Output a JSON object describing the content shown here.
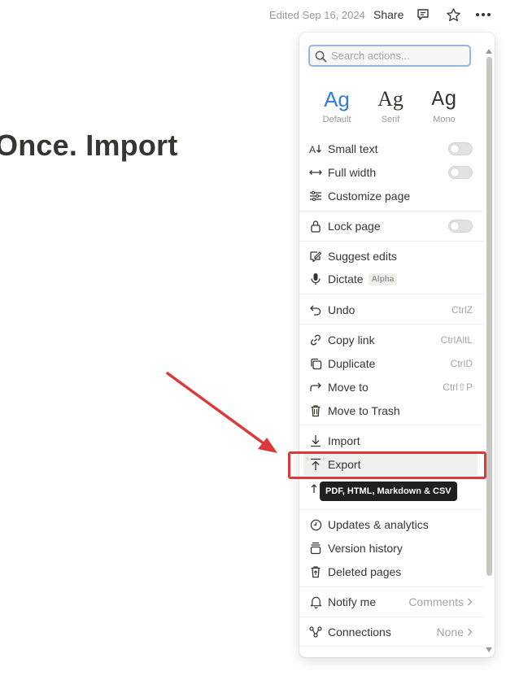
{
  "topbar": {
    "edited": "Edited Sep 16, 2024",
    "share": "Share",
    "icons": [
      "comment-icon",
      "star-icon",
      "more-icon"
    ]
  },
  "page": {
    "title": "Once. Import"
  },
  "menu": {
    "search": {
      "placeholder": "Search actions...",
      "value": ""
    },
    "fonts": [
      {
        "sample": "Ag",
        "label": "Default",
        "color": "#2f80d8",
        "selected": true
      },
      {
        "sample": "Ag",
        "label": "Serif",
        "color": "#37352f"
      },
      {
        "sample": "Ag",
        "label": "Mono",
        "color": "#37352f"
      }
    ],
    "items": {
      "small_text": {
        "label": "Small text",
        "toggle": false
      },
      "full_width": {
        "label": "Full width",
        "toggle": false
      },
      "customize_page": {
        "label": "Customize page"
      },
      "lock_page": {
        "label": "Lock page",
        "toggle": false
      },
      "suggest_edits": {
        "label": "Suggest edits"
      },
      "dictate": {
        "label": "Dictate",
        "badge": "Alpha"
      },
      "undo": {
        "label": "Undo",
        "shortcut": "CtrlZ"
      },
      "copy_link": {
        "label": "Copy link",
        "shortcut": "CtrlAltL"
      },
      "duplicate": {
        "label": "Duplicate",
        "shortcut": "CtrlD"
      },
      "move_to": {
        "label": "Move to",
        "shortcut": "Ctrl⇧P"
      },
      "move_to_trash": {
        "label": "Move to Trash"
      },
      "import": {
        "label": "Import"
      },
      "export": {
        "label": "Export"
      },
      "updates": {
        "label": "Updates & analytics"
      },
      "version_history": {
        "label": "Version history"
      },
      "deleted_pages": {
        "label": "Deleted pages"
      },
      "notify_me": {
        "label": "Notify me",
        "value": "Comments"
      },
      "connections": {
        "label": "Connections",
        "value": "None"
      }
    },
    "tooltip": "PDF, HTML, Markdown & CSV"
  },
  "annotation": {
    "color": "#dc3a3a"
  }
}
